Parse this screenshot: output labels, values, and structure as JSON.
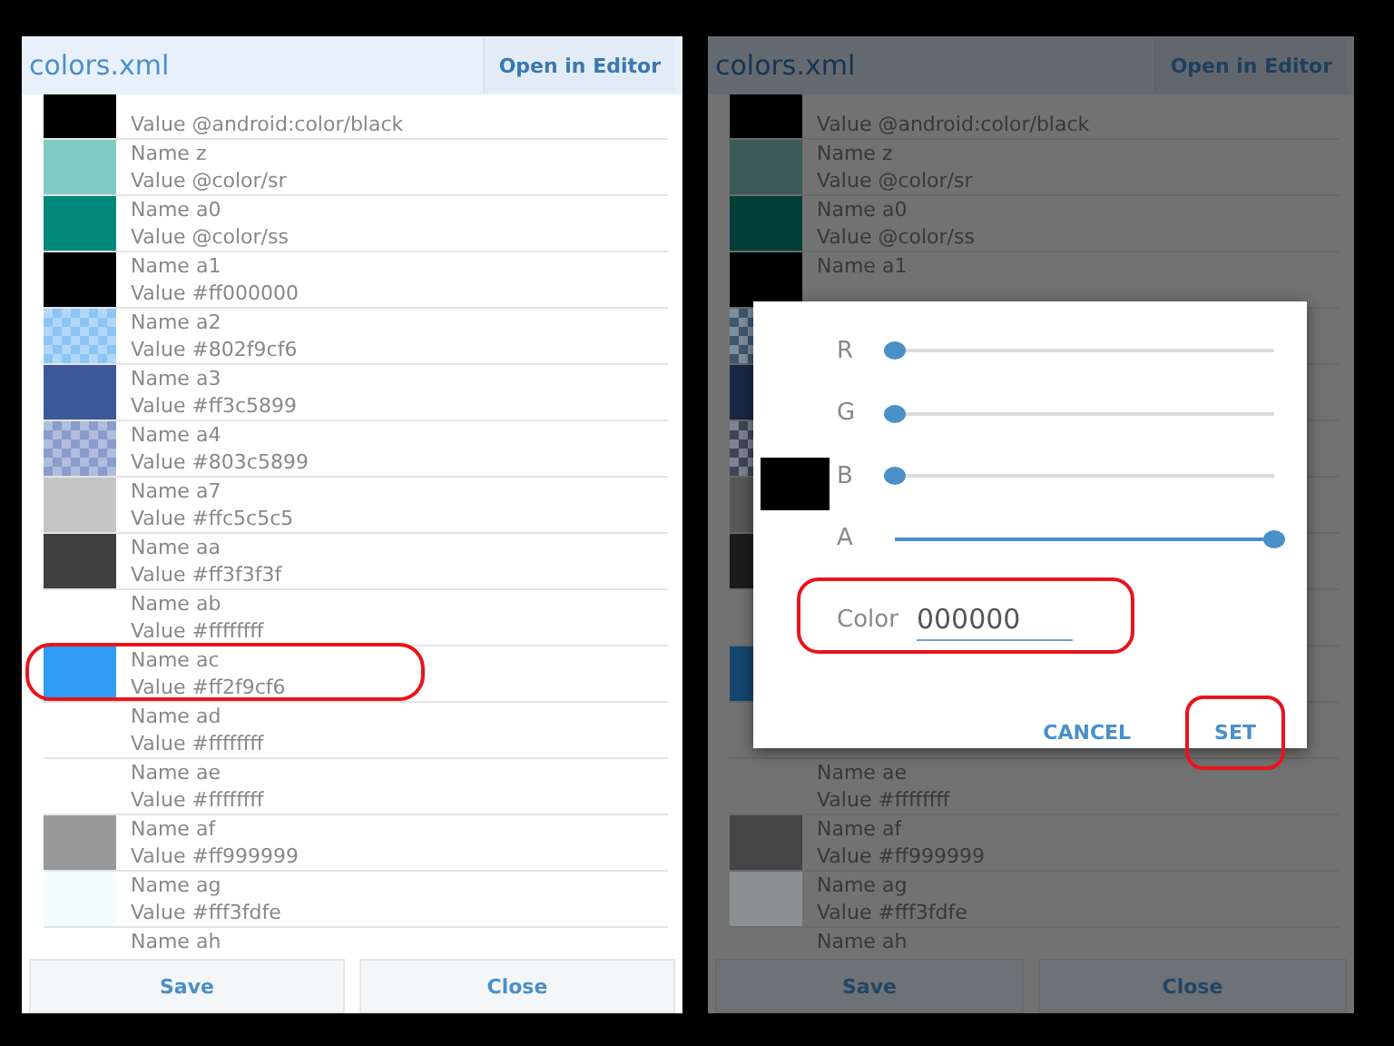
{
  "panels": [
    {
      "title": "colors.xml",
      "header_button": "Open in Editor",
      "dimmed": false,
      "rows": [
        {
          "kind": "solid",
          "color": "#000000",
          "value": "Value  @android:color/black"
        },
        {
          "kind": "solid",
          "color": "#80cbc4",
          "name": "Name z",
          "value": "Value  @color/sr"
        },
        {
          "kind": "solid",
          "color": "#00897b",
          "name": "Name a0",
          "value": "Value  @color/ss"
        },
        {
          "kind": "solid",
          "color": "#000000",
          "name": "Name a1",
          "value": "Value  #ff000000"
        },
        {
          "kind": "checker",
          "color": "#8cc4f5",
          "name": "Name a2",
          "value": "Value  #802f9cf6"
        },
        {
          "kind": "solid",
          "color": "#3c5899",
          "name": "Name a3",
          "value": "Value  #ff3c5899"
        },
        {
          "kind": "checker",
          "color": "#8a9ccb",
          "name": "Name a4",
          "value": "Value  #803c5899"
        },
        {
          "kind": "solid",
          "color": "#c5c5c5",
          "name": "Name a7",
          "value": "Value  #ffc5c5c5"
        },
        {
          "kind": "solid",
          "color": "#3f3f3f",
          "name": "Name aa",
          "value": "Value  #ff3f3f3f"
        },
        {
          "kind": "empty",
          "name": "Name ab",
          "value": "Value  #ffffffff"
        },
        {
          "kind": "solid",
          "color": "#2f9cf6",
          "name": "Name ac",
          "value": "Value  #ff2f9cf6",
          "highlighted": true
        },
        {
          "kind": "empty",
          "name": "Name ad",
          "value": "Value  #ffffffff"
        },
        {
          "kind": "empty",
          "name": "Name ae",
          "value": "Value  #ffffffff"
        },
        {
          "kind": "solid",
          "color": "#999999",
          "name": "Name af",
          "value": "Value  #ff999999"
        },
        {
          "kind": "solid",
          "color": "#f3fdfe",
          "name": "Name ag",
          "value": "Value  #fff3fdfe"
        },
        {
          "kind": "empty",
          "name": "Name ah"
        }
      ],
      "footer_buttons": [
        "Save",
        "Close"
      ]
    },
    {
      "title": "colors.xml",
      "header_button": "Open in Editor",
      "dimmed": true,
      "rows": [
        {
          "kind": "solid",
          "color": "#000000",
          "value": "Value  @android:color/black"
        },
        {
          "kind": "solid",
          "color": "#3a5b58",
          "name": "Name z",
          "value": "Value  @color/sr"
        },
        {
          "kind": "solid",
          "color": "#003d37",
          "name": "Name a0",
          "value": "Value  @color/ss"
        },
        {
          "kind": "solid",
          "color": "#000000",
          "name": "Name a1"
        },
        {
          "kind": "checker",
          "color": "#3f586e"
        },
        {
          "kind": "solid",
          "color": "#1b2845"
        },
        {
          "kind": "checker",
          "color": "#3e4659"
        },
        {
          "kind": "solid",
          "color": "#585858"
        },
        {
          "kind": "solid",
          "color": "#1c1c1c"
        },
        {
          "kind": "empty"
        },
        {
          "kind": "solid",
          "color": "#154670"
        },
        {
          "kind": "empty"
        },
        {
          "kind": "empty",
          "name": "Name ae",
          "value": "Value  #ffffffff"
        },
        {
          "kind": "solid",
          "color": "#454545",
          "name": "Name af",
          "value": "Value  #ff999999"
        },
        {
          "kind": "solid",
          "color": "#8a9192",
          "name": "Name ag",
          "value": "Value  #fff3fdfe"
        },
        {
          "kind": "empty",
          "name": "Name ah"
        }
      ],
      "footer_buttons": [
        "Save",
        "Close"
      ],
      "dialog": {
        "preview": {
          "color": "#000000"
        },
        "sliders": [
          {
            "label": "R",
            "level": 0
          },
          {
            "label": "G",
            "level": 0
          },
          {
            "label": "B",
            "level": 0
          },
          {
            "label": "A",
            "level": 1
          }
        ],
        "color_field": {
          "label": "Color",
          "value": "000000",
          "highlighted": true
        },
        "buttons": [
          {
            "label": "CANCEL",
            "highlighted": false
          },
          {
            "label": "SET",
            "highlighted": true
          }
        ]
      }
    }
  ]
}
